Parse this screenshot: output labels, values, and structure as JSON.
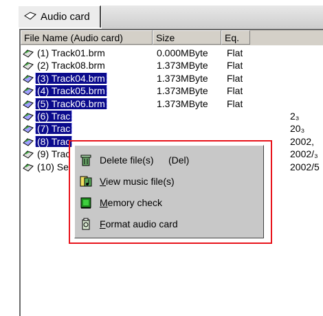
{
  "tab": {
    "label": "Audio card"
  },
  "columns": [
    "File Name (Audio card)",
    "Size",
    "Eq."
  ],
  "rows": [
    {
      "name": "(1) Track01.brm",
      "size": "0.000MByte",
      "eq": "Flat",
      "date": "",
      "selected": false
    },
    {
      "name": "(2) Track08.brm",
      "size": "1.373MByte",
      "eq": "Flat",
      "date": "",
      "selected": false
    },
    {
      "name": "(3) Track04.brm",
      "size": "1.373MByte",
      "eq": "Flat",
      "date": "",
      "selected": true
    },
    {
      "name": "(4) Track05.brm",
      "size": "1.373MByte",
      "eq": "Flat",
      "date": "",
      "selected": true
    },
    {
      "name": "(5) Track06.brm",
      "size": "1.373MByte",
      "eq": "Flat",
      "date": "",
      "selected": true
    },
    {
      "name": "(6) Trac",
      "size": "",
      "eq": "",
      "date": "2₃",
      "selected": true
    },
    {
      "name": "(7) Trac",
      "size": "",
      "eq": "",
      "date": "20₃",
      "selected": true
    },
    {
      "name": "(8) Trac",
      "size": "",
      "eq": "",
      "date": "2002,",
      "selected": true
    },
    {
      "name": "(9) Trac",
      "size": "",
      "eq": "",
      "date": "2002/₃",
      "selected": false
    },
    {
      "name": "(10) Se",
      "size": "",
      "eq": "",
      "date": "2002/5",
      "selected": false
    }
  ],
  "context_menu": {
    "delete": {
      "label": "Delete file(s)",
      "shortcut": "(Del)"
    },
    "view": {
      "label": "View music file(s)",
      "mnemonic": "V",
      "rest": "iew music file(s)"
    },
    "memory": {
      "label": "Memory check",
      "mnemonic": "M",
      "rest": "emory check"
    },
    "format": {
      "label": "Format audio card",
      "mnemonic": "F",
      "rest": "ormat audio card"
    }
  },
  "colors": {
    "selection": "#0a0a8c",
    "highlight_box": "#e8121a",
    "menu_bg": "#c8c8c8"
  }
}
